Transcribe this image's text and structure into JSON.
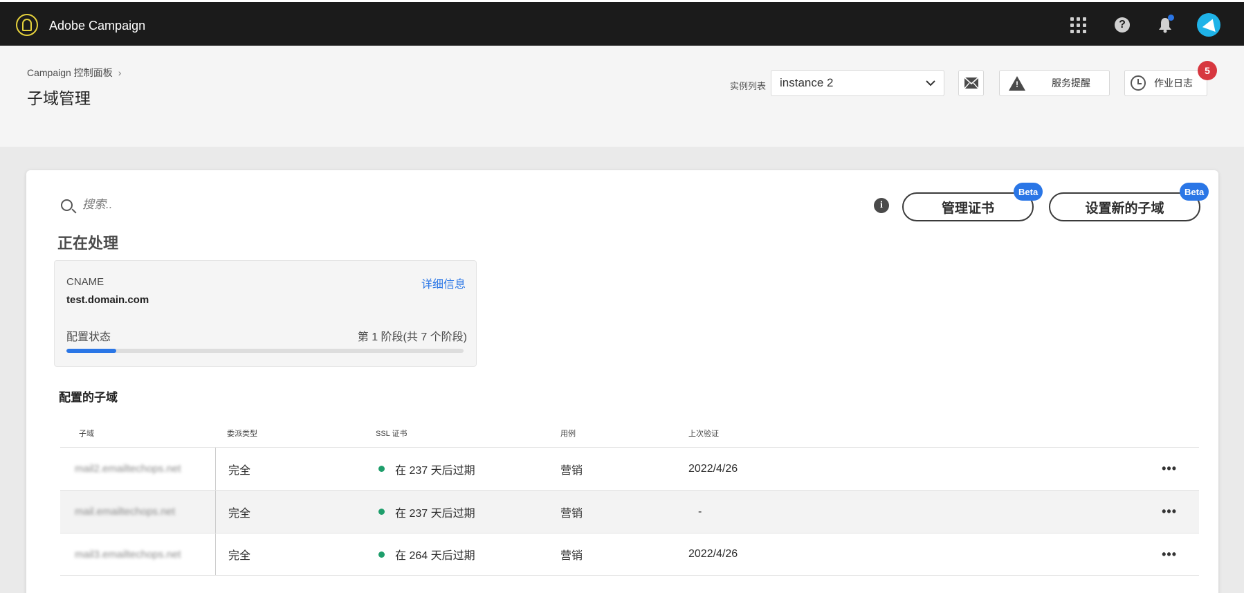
{
  "app": {
    "title": "Adobe Campaign"
  },
  "topbar": {
    "icons": [
      "apps-icon",
      "help-icon",
      "bell-icon",
      "avatar"
    ],
    "notification_dot_color": "#2a76e6"
  },
  "header": {
    "breadcrumb": "Campaign 控制面板",
    "title": "子域管理",
    "instance_label": "实例列表",
    "instance_value": "instance 2",
    "service_alerts_label": "服务提醒",
    "job_log_label": "作业日志",
    "job_log_count": "5"
  },
  "toolbar": {
    "search_placeholder": "搜索..",
    "manage_cert_label": "管理证书",
    "new_subdomain_label": "设置新的子域",
    "beta_label": "Beta"
  },
  "processing": {
    "title": "正在处理",
    "type_label": "CNAME",
    "domain": "test.domain.com",
    "details_link": "详细信息",
    "status_label": "配置状态",
    "stage_text": "第 1 阶段(共 7 个阶段)",
    "progress_fraction": 0.125
  },
  "subdomains": {
    "title": "配置的子域",
    "headers": {
      "subdomain": "子域",
      "delegation": "委派类型",
      "ssl": "SSL 证书",
      "use_case": "用例",
      "last_verified": "上次验证"
    },
    "rows": [
      {
        "subdomain": "mail2.emailtechops.net",
        "delegation": "完全",
        "ssl": "在 237 天后过期",
        "use_case": "营销",
        "last_verified": "2022/4/26",
        "more": "•••"
      },
      {
        "subdomain": "mail.emailtechops.net",
        "delegation": "完全",
        "ssl": "在 237 天后过期",
        "use_case": "营销",
        "last_verified": "-",
        "more": "•••"
      },
      {
        "subdomain": "mail3.emailtechops.net",
        "delegation": "完全",
        "ssl": "在 264 天后过期",
        "use_case": "营销",
        "last_verified": "2022/4/26",
        "more": "•••"
      }
    ]
  },
  "colors": {
    "accent": "#2a76e6",
    "ssl_ok": "#1e9e6b",
    "badge": "#d7373f",
    "topbar": "#1b1b1b"
  }
}
